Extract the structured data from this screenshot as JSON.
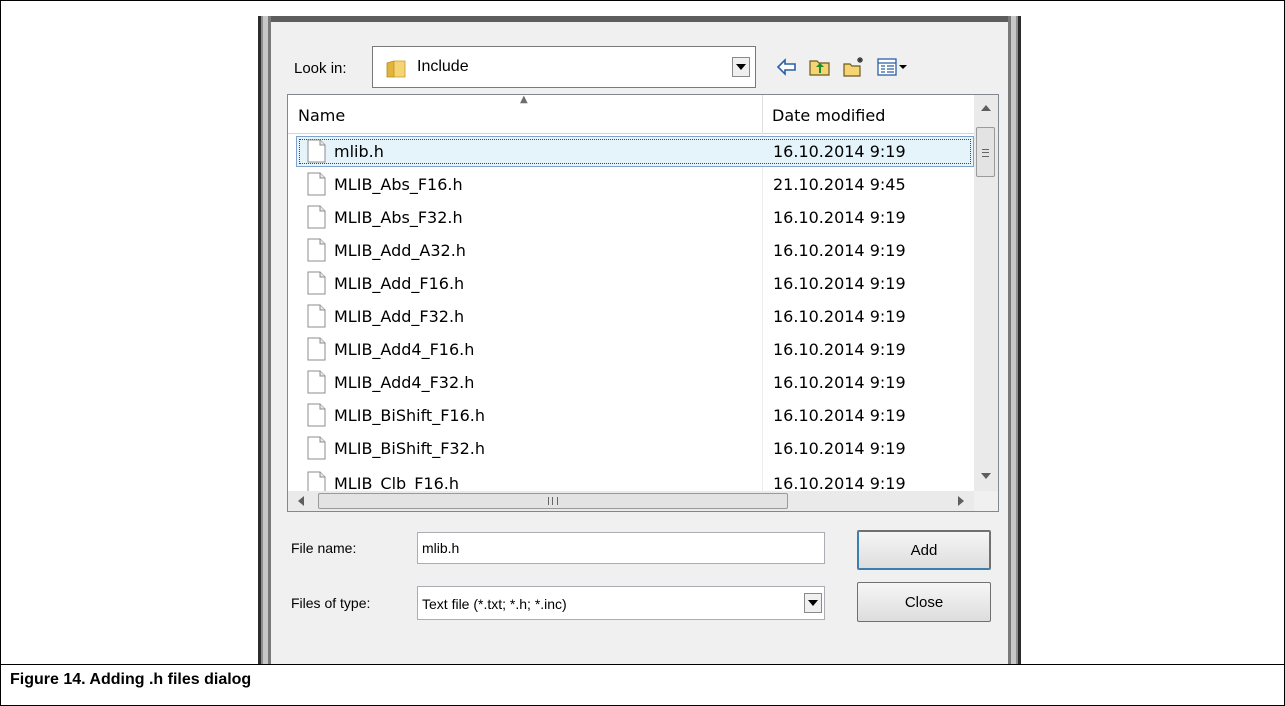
{
  "dialog": {
    "look_in_label": "Look in:",
    "look_in_value": "Include",
    "toolbar": [
      "back-arrow-icon",
      "up-folder-icon",
      "new-folder-icon",
      "view-menu-icon"
    ],
    "columns": {
      "name": "Name",
      "date_modified": "Date modified"
    },
    "files": [
      {
        "name": "mlib.h",
        "date": "16.10.2014 9:19",
        "selected": true
      },
      {
        "name": "MLIB_Abs_F16.h",
        "date": "21.10.2014 9:45"
      },
      {
        "name": "MLIB_Abs_F32.h",
        "date": "16.10.2014 9:19"
      },
      {
        "name": "MLIB_Add_A32.h",
        "date": "16.10.2014 9:19"
      },
      {
        "name": "MLIB_Add_F16.h",
        "date": "16.10.2014 9:19"
      },
      {
        "name": "MLIB_Add_F32.h",
        "date": "16.10.2014 9:19"
      },
      {
        "name": "MLIB_Add4_F16.h",
        "date": "16.10.2014 9:19"
      },
      {
        "name": "MLIB_Add4_F32.h",
        "date": "16.10.2014 9:19"
      },
      {
        "name": "MLIB_BiShift_F16.h",
        "date": "16.10.2014 9:19"
      },
      {
        "name": "MLIB_BiShift_F32.h",
        "date": "16.10.2014 9:19"
      },
      {
        "name": "MLIB_Clb_F16.h",
        "date": "16.10.2014 9:19"
      }
    ],
    "file_name_label": "File name:",
    "file_name_value": "mlib.h",
    "files_of_type_label": "Files of type:",
    "files_of_type_value": "Text file (*.txt; *.h; *.inc)",
    "add_button": "Add",
    "close_button": "Close"
  },
  "caption": "Figure 14.  Adding .h files dialog"
}
